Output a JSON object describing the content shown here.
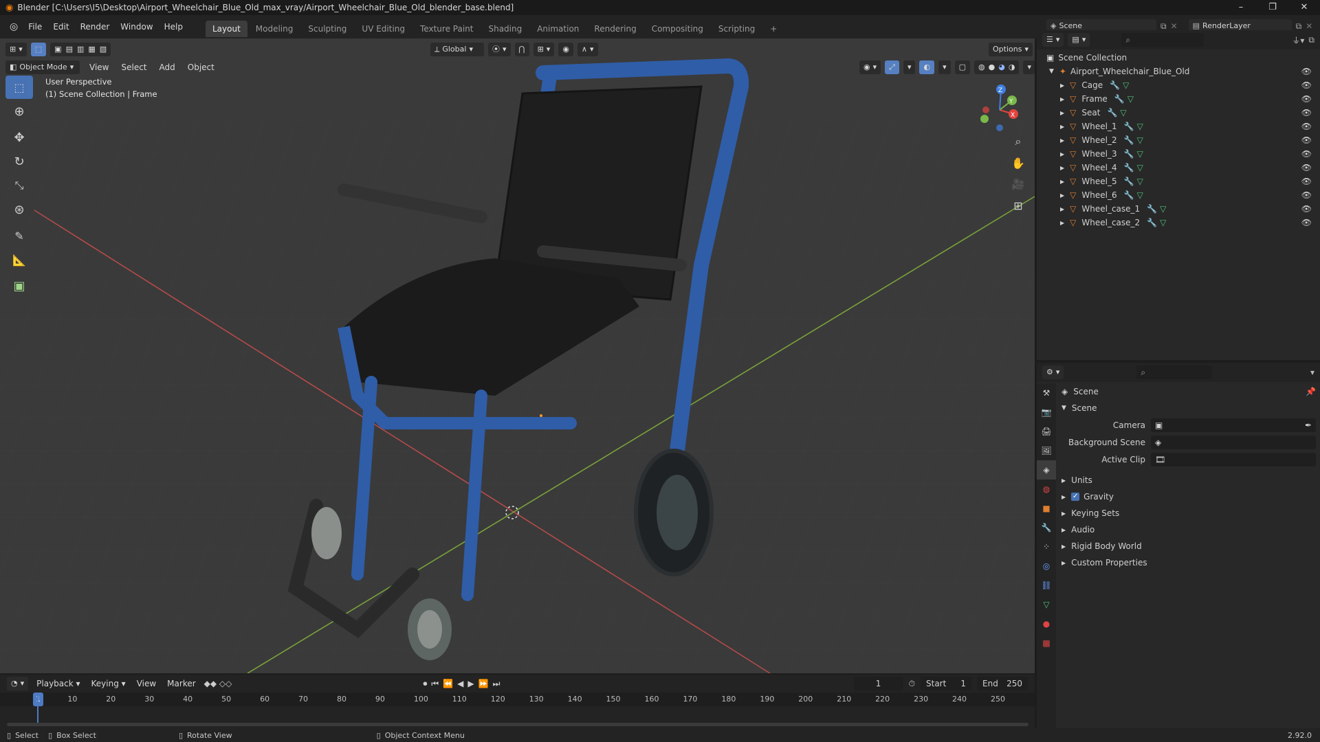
{
  "titlebar": {
    "title": "Blender [C:\\Users\\I5\\Desktop\\Airport_Wheelchair_Blue_Old_max_vray/Airport_Wheelchair_Blue_Old_blender_base.blend]",
    "min": "–",
    "max": "❐",
    "close": "✕"
  },
  "menu": {
    "items": [
      "File",
      "Edit",
      "Render",
      "Window",
      "Help"
    ]
  },
  "workspaces": [
    "Layout",
    "Modeling",
    "Sculpting",
    "UV Editing",
    "Texture Paint",
    "Shading",
    "Animation",
    "Rendering",
    "Compositing",
    "Scripting"
  ],
  "workspace_add": "+",
  "scene": {
    "label": "Scene",
    "render_layer": "RenderLayer"
  },
  "viewport": {
    "mode": "Object Mode",
    "menus": [
      "View",
      "Select",
      "Add",
      "Object"
    ],
    "transform": "Global",
    "options": "Options",
    "overlay_title": "User Perspective",
    "overlay_sub": "(1) Scene Collection | Frame",
    "gizmo": {
      "x": "X",
      "y": "Y",
      "z": "Z"
    }
  },
  "outliner": {
    "root": "Scene Collection",
    "collection": "Airport_Wheelchair_Blue_Old",
    "objects": [
      "Cage",
      "Frame",
      "Seat",
      "Wheel_1",
      "Wheel_2",
      "Wheel_3",
      "Wheel_4",
      "Wheel_5",
      "Wheel_6",
      "Wheel_case_1",
      "Wheel_case_2"
    ]
  },
  "properties": {
    "header": "Scene",
    "panel": "Scene",
    "camera_label": "Camera",
    "bg_scene_label": "Background Scene",
    "active_clip_label": "Active Clip",
    "sections": [
      "Units",
      "Gravity",
      "Keying Sets",
      "Audio",
      "Rigid Body World",
      "Custom Properties"
    ]
  },
  "timeline": {
    "menus": [
      "Playback",
      "Keying",
      "View",
      "Marker"
    ],
    "current_frame": "1",
    "start_label": "Start",
    "start": "1",
    "end_label": "End",
    "end": "250",
    "ticks": [
      "1",
      "10",
      "20",
      "30",
      "40",
      "50",
      "60",
      "70",
      "80",
      "90",
      "100",
      "110",
      "120",
      "130",
      "140",
      "150",
      "160",
      "170",
      "180",
      "190",
      "200",
      "210",
      "220",
      "230",
      "240",
      "250"
    ]
  },
  "status": {
    "select": "Select",
    "box_select": "Box Select",
    "rotate": "Rotate View",
    "context": "Object Context Menu",
    "version": "2.92.0"
  },
  "colors": {
    "accent": "#4772b3",
    "mesh_icon": "#e07f2f",
    "frame_current": "#4d7bc4"
  }
}
